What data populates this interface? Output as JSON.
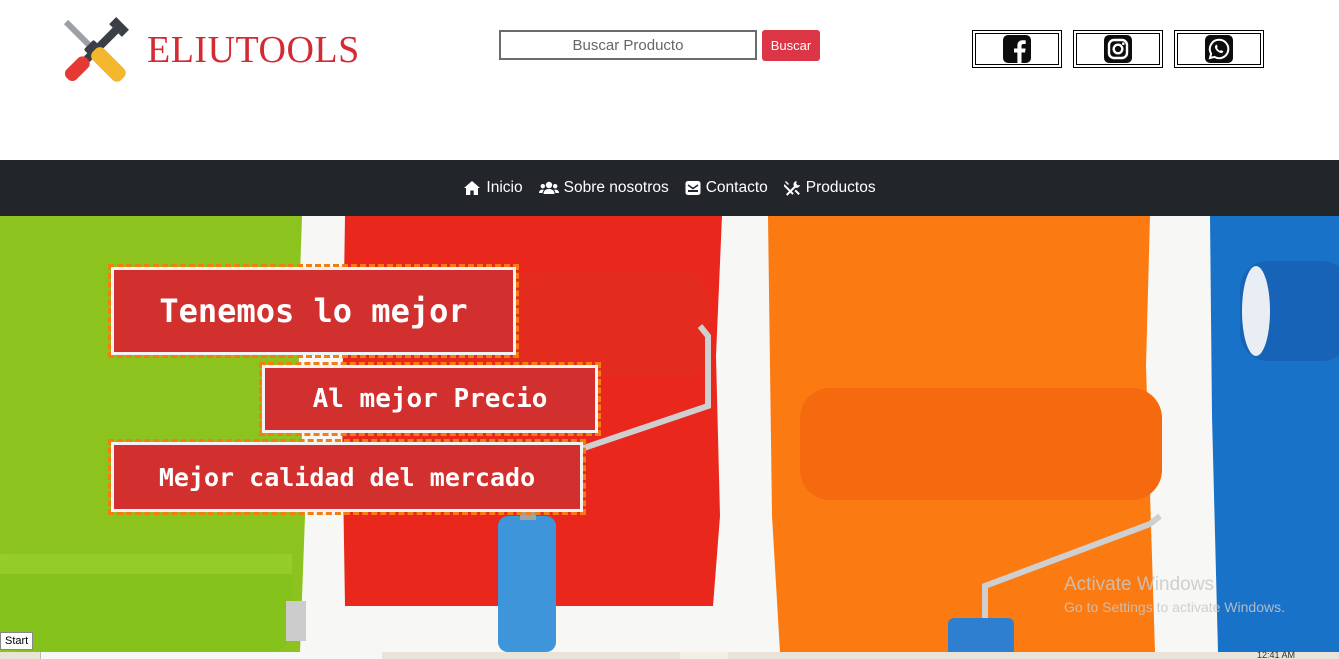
{
  "brand": {
    "name": "ELIUTOOLS",
    "logo_icon": "tools-icon"
  },
  "search": {
    "placeholder": "Buscar Producto",
    "value": "",
    "button_label": "Buscar"
  },
  "social": [
    {
      "name": "facebook",
      "icon": "facebook-icon"
    },
    {
      "name": "instagram",
      "icon": "instagram-icon"
    },
    {
      "name": "whatsapp",
      "icon": "whatsapp-icon"
    }
  ],
  "nav": {
    "items": [
      {
        "label": "Inicio",
        "icon": "home-icon"
      },
      {
        "label": "Sobre nosotros",
        "icon": "users-icon"
      },
      {
        "label": "Contacto",
        "icon": "envelope-icon"
      },
      {
        "label": "Productos",
        "icon": "tools-icon"
      }
    ]
  },
  "hero": {
    "taglines": [
      "Tenemos lo mejor",
      "Al mejor Precio",
      "Mejor calidad del mercado"
    ],
    "colors": {
      "tag_bg": "#d2302f",
      "tag_dash": "#f57c0f"
    }
  },
  "watermark": {
    "title": "Activate Windows",
    "subtitle": "Go to Settings to activate Windows."
  },
  "taskbar": {
    "start_label": "Start",
    "clock": "12:41 AM"
  },
  "colors": {
    "brand": "#d42a34",
    "navbar": "#22252a",
    "button": "#dc3545"
  }
}
